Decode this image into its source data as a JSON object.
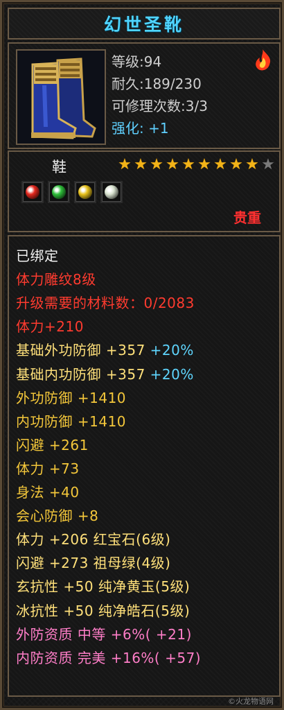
{
  "item": {
    "name": "幻世圣靴",
    "level_line": "等级:94",
    "durability_line": "耐久:189/230",
    "repair_line": "可修理次数:3/3",
    "enhance_line": "强化: +1",
    "type": "鞋",
    "stars_total": 10,
    "stars_filled": 9,
    "rarity_label": "贵重"
  },
  "gems": [
    {
      "name": "red-gem",
      "color": "#e4281e"
    },
    {
      "name": "green-gem",
      "color": "#2fbf3a"
    },
    {
      "name": "yellow-gem",
      "color": "#e8c21c"
    },
    {
      "name": "white-gem",
      "color": "#d9e3d0"
    }
  ],
  "stats": [
    {
      "text": "已绑定",
      "color": "c-white"
    },
    {
      "text": "体力雕纹8级",
      "color": "c-red"
    },
    {
      "text": "升级需要的材料数：0/2083",
      "color": "c-red"
    },
    {
      "text": "体力+210",
      "color": "c-red"
    },
    {
      "text": "基础外功防御 +357",
      "extra": " +20%",
      "color": "c-sub",
      "extra_color": "c-cyan"
    },
    {
      "text": "基础内功防御 +357",
      "extra": " +20%",
      "color": "c-sub",
      "extra_color": "c-cyan"
    },
    {
      "text": "外功防御 +1410",
      "color": "c-gold"
    },
    {
      "text": "内功防御 +1410",
      "color": "c-gold"
    },
    {
      "text": "闪避 +261",
      "color": "c-gold"
    },
    {
      "text": "体力 +73",
      "color": "c-gold"
    },
    {
      "text": "身法 +40",
      "color": "c-gold"
    },
    {
      "text": "会心防御 +8",
      "color": "c-gold"
    },
    {
      "text": "体力 +206 红宝石(6级)",
      "color": "c-sub"
    },
    {
      "text": "闪避 +273 祖母绿(4级)",
      "color": "c-sub"
    },
    {
      "text": "玄抗性 +50 纯净黄玉(5级)",
      "color": "c-sub"
    },
    {
      "text": "冰抗性 +50 纯净皓石(5级)",
      "color": "c-sub"
    },
    {
      "text": "外防资质   中等 +6%( +21)",
      "color": "c-pink"
    },
    {
      "text": "内防资质   完美 +16%( +57)",
      "color": "c-pink"
    }
  ],
  "watermark": "©火龙物语网"
}
